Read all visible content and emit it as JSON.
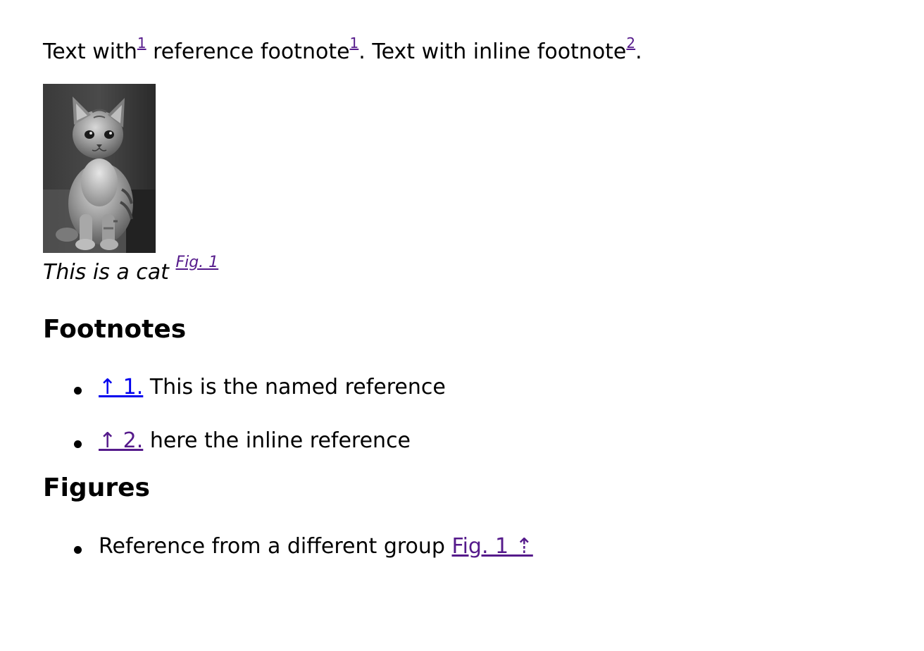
{
  "intro": {
    "text_1": "Text with",
    "ref_1": "1",
    "text_2": " reference footnote",
    "ref_2": "1",
    "text_3": ". Text with inline footnote",
    "ref_3": "2",
    "text_4": "."
  },
  "figure": {
    "caption": "This is a cat",
    "caption_ref": "Fig. 1"
  },
  "footnotes": {
    "heading": "Footnotes",
    "items": [
      {
        "backlink": "↑ 1.",
        "text": " This is the named reference"
      },
      {
        "backlink": "↑ 2.",
        "text": " here the inline reference"
      }
    ]
  },
  "figures": {
    "heading": "Figures",
    "items": [
      {
        "text": "Reference from a different group ",
        "link": "Fig. 1 ⇡"
      }
    ]
  },
  "colors": {
    "visited_link": "#551A8B",
    "unvisited_link": "#0000EE"
  }
}
